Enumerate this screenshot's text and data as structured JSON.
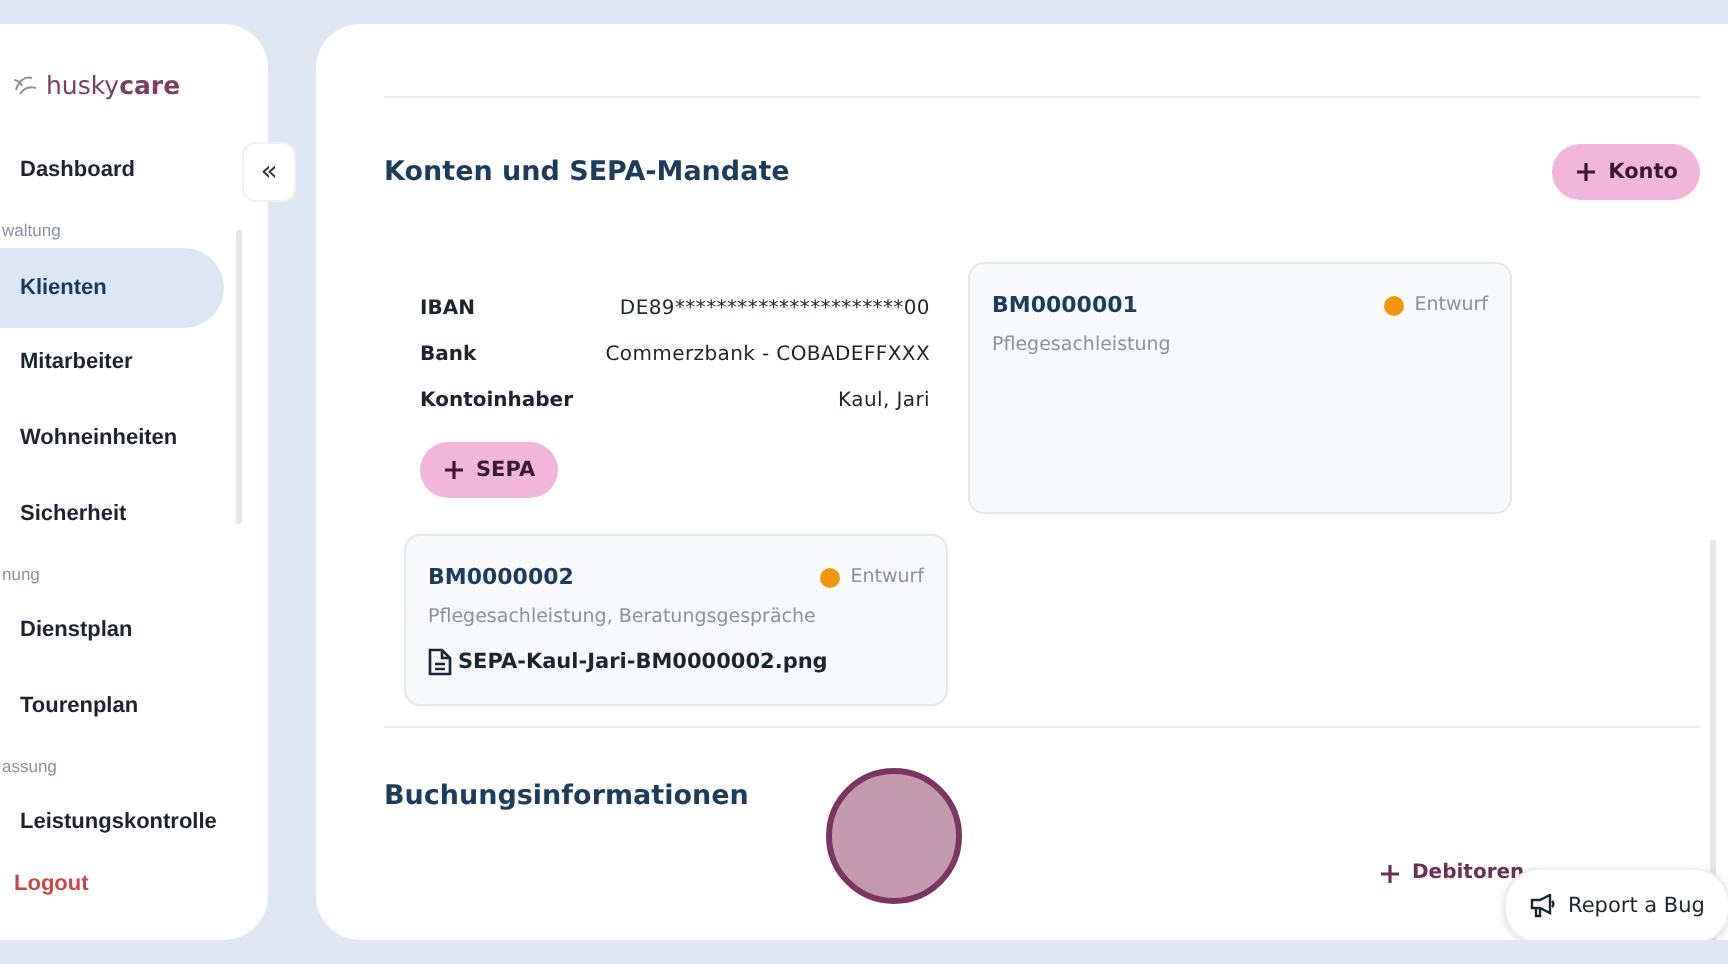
{
  "sidebar": {
    "logo": {
      "first": "husky",
      "second": "care"
    },
    "collapse_button": "«",
    "items": [
      {
        "kind": "link",
        "label": "Dashboard",
        "selected": false
      },
      {
        "kind": "section",
        "label": "waltung"
      },
      {
        "kind": "link",
        "label": "Klienten",
        "selected": true
      },
      {
        "kind": "link",
        "label": "Mitarbeiter",
        "selected": false
      },
      {
        "kind": "link",
        "label": "Wohneinheiten",
        "selected": false
      },
      {
        "kind": "link",
        "label": "Sicherheit",
        "selected": false
      },
      {
        "kind": "section",
        "label": "nung"
      },
      {
        "kind": "link",
        "label": "Dienstplan",
        "selected": false
      },
      {
        "kind": "link",
        "label": "Tourenplan",
        "selected": false
      },
      {
        "kind": "section",
        "label": "assung"
      },
      {
        "kind": "link",
        "label": "Leistungskontrolle",
        "selected": false
      }
    ],
    "logout": "Logout"
  },
  "accounts": {
    "title": "Konten und SEPA-Mandate",
    "add_button": "Konto",
    "fields": [
      {
        "label": "IBAN",
        "value": "DE89**********************00"
      },
      {
        "label": "Bank",
        "value": "Commerzbank - COBADEFFXXX"
      },
      {
        "label": "Kontoinhaber",
        "value": "Kaul, Jari"
      }
    ],
    "sepa_button": "SEPA",
    "mandates": [
      {
        "id": "BM0000001",
        "status": "Entwurf",
        "color": "#f0960f",
        "services": "Pflegesachleistung"
      },
      {
        "id": "BM0000002",
        "status": "Entwurf",
        "color": "#f0960f",
        "services": "Pflegesachleistung, Beratungsgespräche",
        "file": "SEPA-Kaul-Jari-BM0000002.png"
      }
    ]
  },
  "bookings": {
    "title": "Buchungsinformationen",
    "add_button": "Debitoren"
  },
  "report_bug": "Report a Bug"
}
